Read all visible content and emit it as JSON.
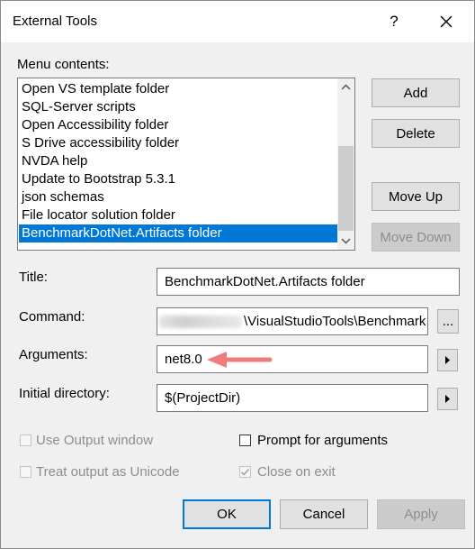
{
  "window": {
    "title": "External Tools",
    "help_symbol": "?"
  },
  "menu": {
    "label": "Menu contents:",
    "items": [
      {
        "label": "Open VS template folder",
        "selected": false
      },
      {
        "label": "SQL-Server scripts",
        "selected": false
      },
      {
        "label": "Open Accessibility folder",
        "selected": false
      },
      {
        "label": "S Drive accessibility folder",
        "selected": false
      },
      {
        "label": "NVDA help",
        "selected": false
      },
      {
        "label": "Update to Bootstrap 5.3.1",
        "selected": false
      },
      {
        "label": "json schemas",
        "selected": false
      },
      {
        "label": "File locator solution folder",
        "selected": false
      },
      {
        "label": "BenchmarkDotNet.Artifacts folder",
        "selected": true
      }
    ]
  },
  "buttons": {
    "add": "Add",
    "delete": "Delete",
    "move_up": "Move Up",
    "move_down": "Move Down",
    "ok": "OK",
    "cancel": "Cancel",
    "apply": "Apply",
    "browse": "..."
  },
  "fields": {
    "title": {
      "label": "Title:",
      "value": "BenchmarkDotNet.Artifacts folder"
    },
    "command": {
      "label": "Command:",
      "value": "\\VisualStudioTools\\Benchmark"
    },
    "arguments": {
      "label": "Arguments:",
      "value": "net8.0"
    },
    "initial_directory": {
      "label": "Initial directory:",
      "value": "$(ProjectDir)"
    }
  },
  "options": {
    "use_output_window": {
      "label": "Use Output window",
      "checked": false,
      "enabled": false
    },
    "prompt_for_arguments": {
      "label": "Prompt for arguments",
      "checked": false,
      "enabled": true
    },
    "treat_output_as_unicode": {
      "label": "Treat output as Unicode",
      "checked": false,
      "enabled": false
    },
    "close_on_exit": {
      "label": "Close on exit",
      "checked": true,
      "enabled": false
    }
  },
  "colors": {
    "selection": "#0078d7",
    "annotation_arrow": "#f07b7b"
  },
  "icons": {
    "close": "close-icon",
    "scroll_up": "chevron-up-icon",
    "scroll_down": "chevron-down-icon",
    "argument_menu": "triangle-right-icon",
    "annotation": "arrow-left-icon"
  }
}
